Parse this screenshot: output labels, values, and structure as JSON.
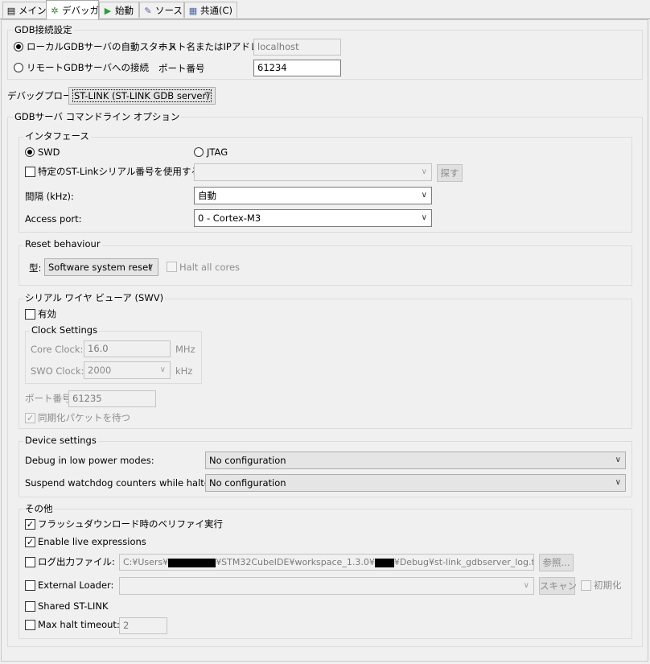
{
  "tabs": [
    {
      "label": "メイン",
      "icon": "document-icon"
    },
    {
      "label": "デバッガ",
      "icon": "bug-icon"
    },
    {
      "label": "始動",
      "icon": "play-icon"
    },
    {
      "label": "ソース",
      "icon": "source-icon"
    },
    {
      "label": "共通(C)",
      "icon": "common-icon"
    }
  ],
  "gdb": {
    "title": "GDB接続設定",
    "local_label": "ローカルGDBサーバの自動スタート",
    "remote_label": "リモートGDBサーバへの接続",
    "host_label": "ホスト名またはIPアドレス",
    "host_value": "localhost",
    "port_label": "ポート番号",
    "port_value": "61234"
  },
  "probe": {
    "label": "デバッグプローブ",
    "value": "ST-LINK (ST-LINK GDB server)"
  },
  "cmdline": {
    "title": "GDBサーバ コマンドライン オプション"
  },
  "iface": {
    "title": "インタフェース",
    "swd": "SWD",
    "jtag": "JTAG",
    "serial_label": "特定のST-Linkシリアル番号を使用する",
    "find_button": "探す",
    "freq_label": "間隔 (kHz):",
    "freq_value": "自動",
    "ap_label": "Access port:",
    "ap_value": "0 - Cortex-M3"
  },
  "reset": {
    "title": "Reset behaviour",
    "type_label": "型:",
    "type_value": "Software system reset",
    "halt_label": "Halt all cores"
  },
  "swv": {
    "title": "シリアル ワイヤ ビューア (SWV)",
    "enable_label": "有効",
    "clock_title": "Clock Settings",
    "core_label": "Core Clock:",
    "core_value": "16.0",
    "core_unit": "MHz",
    "swo_label": "SWO Clock:",
    "swo_value": "2000",
    "swo_unit": "kHz",
    "port_label": "ポート番号",
    "port_value": "61235",
    "sync_label": "同期化パケットを待つ"
  },
  "device": {
    "title": "Device settings",
    "lowpower_label": "Debug in low power modes:",
    "lowpower_value": "No configuration",
    "watchdog_label": "Suspend watchdog counters while halted:",
    "watchdog_value": "No configuration"
  },
  "other": {
    "title": "その他",
    "verify_label": "フラッシュダウンロード時のベリファイ実行",
    "live_label": "Enable live expressions",
    "log_label": "ログ出力ファイル:",
    "log_path_1": "C:¥Users¥",
    "log_path_2": "¥STM32CubeIDE¥workspace_1.3.0¥",
    "log_path_3": "¥Debug¥st-link_gdbserver_log.txt",
    "browse_button": "参照...",
    "ext_label": "External Loader:",
    "scan_button": "スキャン",
    "init_label": "初期化",
    "shared_label": "Shared ST-LINK",
    "halt_timeout_label": "Max halt timeout:",
    "halt_timeout_value": "2"
  }
}
